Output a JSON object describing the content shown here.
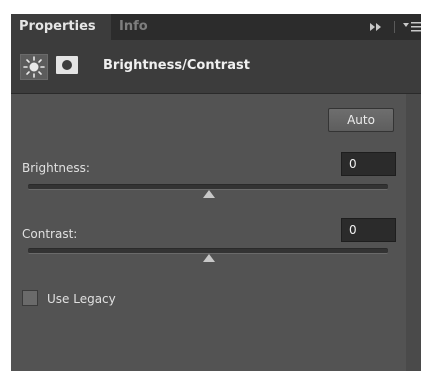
{
  "tabs": [
    {
      "label": "Properties",
      "active": true
    },
    {
      "label": "Info",
      "active": false
    }
  ],
  "header": {
    "adjustment_icon": "brightness-sun-icon",
    "mask_icon": "layer-mask-icon",
    "title": "Brightness/Contrast"
  },
  "controls": {
    "auto_label": "Auto",
    "brightness": {
      "label": "Brightness:",
      "value": "0"
    },
    "contrast": {
      "label": "Contrast:",
      "value": "0"
    },
    "legacy": {
      "label": "Use Legacy",
      "checked": false
    }
  },
  "colors": {
    "panel_bg": "#535353",
    "tabbar_bg": "#2c2c2c",
    "header_bg": "#3c3c3c",
    "input_bg": "#2b2b2b"
  }
}
